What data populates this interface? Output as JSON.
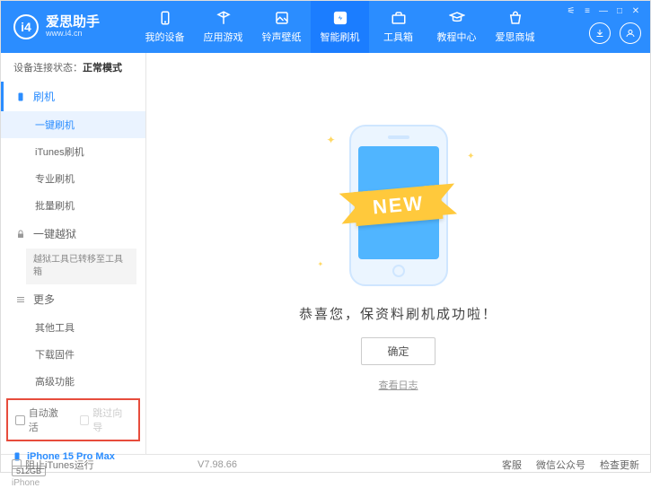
{
  "brand": {
    "name": "爱思助手",
    "url": "www.i4.cn",
    "logo_letter": "i4"
  },
  "nav": {
    "items": [
      {
        "label": "我的设备"
      },
      {
        "label": "应用游戏"
      },
      {
        "label": "铃声壁纸"
      },
      {
        "label": "智能刷机"
      },
      {
        "label": "工具箱"
      },
      {
        "label": "教程中心"
      },
      {
        "label": "爱思商城"
      }
    ],
    "active_index": 3
  },
  "connection": {
    "prefix": "设备连接状态：",
    "status": "正常模式"
  },
  "sidebar": {
    "flash_section": {
      "title": "刷机",
      "items": [
        "一键刷机",
        "iTunes刷机",
        "专业刷机",
        "批量刷机"
      ],
      "active_index": 0
    },
    "jailbreak_section": {
      "title": "一键越狱",
      "note": "越狱工具已转移至工具箱"
    },
    "more_section": {
      "title": "更多",
      "items": [
        "其他工具",
        "下载固件",
        "高级功能"
      ]
    }
  },
  "options": {
    "auto_activate": "自动激活",
    "skip_setup": "跳过向导"
  },
  "device": {
    "name": "iPhone 15 Pro Max",
    "storage": "512GB",
    "type": "iPhone"
  },
  "main": {
    "ribbon": "NEW",
    "success_text": "恭喜您，保资料刷机成功啦！",
    "ok_button": "确定",
    "log_link": "查看日志"
  },
  "footer": {
    "block_itunes": "阻止iTunes运行",
    "version": "V7.98.66",
    "links": [
      "客服",
      "微信公众号",
      "检查更新"
    ]
  }
}
